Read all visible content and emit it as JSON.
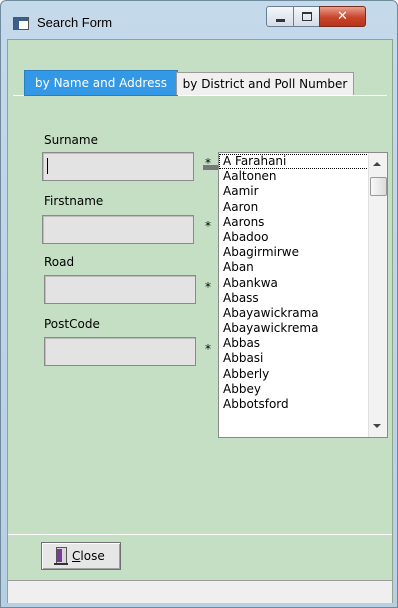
{
  "window": {
    "title": "Search Form"
  },
  "tabs": {
    "active_label": "by Name and Address",
    "inactive_label": "by District and Poll Number"
  },
  "form": {
    "surname_label": "Surname",
    "firstname_label": "Firstname",
    "road_label": "Road",
    "postcode_label": "PostCode",
    "surname_value": "",
    "firstname_value": "",
    "road_value": "",
    "postcode_value": "",
    "required_marker": "*"
  },
  "surname_list": {
    "items": [
      "A Farahani",
      "Aaltonen",
      "Aamir",
      "Aaron",
      "Aarons",
      "Abadoo",
      "Abagirmirwe",
      "Aban",
      "Abankwa",
      "Abass",
      "Abayawickrama",
      "Abayawickrema",
      "Abbas",
      "Abbasi",
      "Abberly",
      "Abbey",
      "Abbotsford"
    ],
    "selected_index": 0
  },
  "footer": {
    "close_label_accel": "C",
    "close_label_rest": "lose"
  },
  "icons": [
    "app-window-icon",
    "minimize-icon",
    "maximize-icon",
    "close-icon",
    "exit-door-icon",
    "scroll-up-arrow-icon",
    "scroll-down-arrow-icon"
  ],
  "colors": {
    "form_background": "#c4dfc4",
    "active_tab": "#3399e6",
    "close_button": "#c8452a"
  }
}
